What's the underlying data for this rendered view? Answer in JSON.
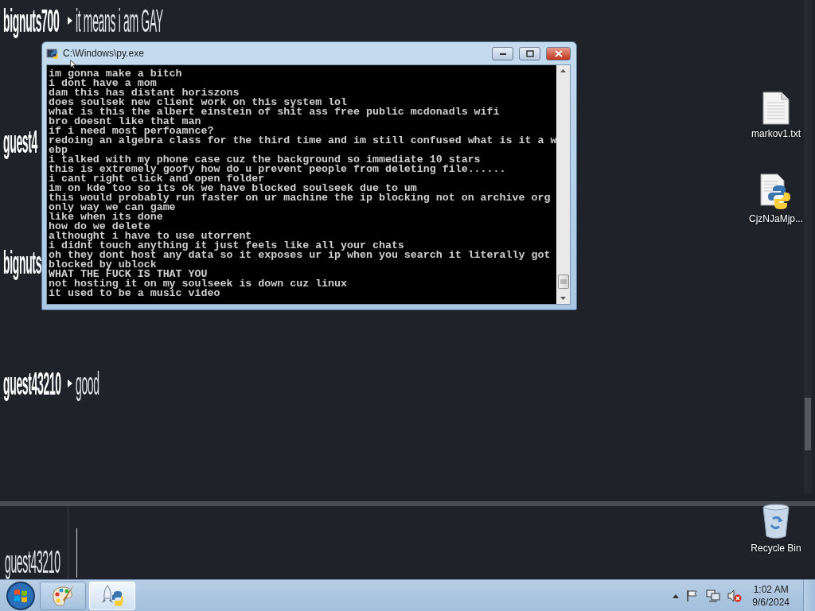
{
  "chat": {
    "messages": [
      {
        "user": "bignuts700",
        "text": "it means i am GAY"
      },
      {
        "user": "guest4"
      },
      {
        "user": "bignuts"
      },
      {
        "user": "guest43210",
        "text": "good"
      }
    ],
    "input": {
      "user": "guest43210"
    }
  },
  "console": {
    "title": "C:\\Windows\\py.exe",
    "lines": [
      "im gonna make a bitch",
      "i dont have a mom",
      "dam this has distant horiszons",
      "does soulsek new client work on this system lol",
      "what is this the albert einstein of shit ass free public mcdonadls wifi",
      "bro doesnt like that man",
      "if i need most perfoamnce?",
      "redoing an algebra class for the third time and im still confused what is it a w",
      "ebp",
      "i talked with my phone case cuz the background so immediate 10 stars",
      "this is extremely goofy how do u prevent people from deleting file......",
      "i cant right click and open folder",
      "im on kde too so its ok we have blocked soulseek due to um",
      "this would probably run faster on ur machine the ip blocking not on archive org",
      "only way we can game",
      "like when its done",
      "how do we delete",
      "althought i have to use utorrent",
      "i didnt touch anything it just feels like all your chats",
      "oh they dont host any data so it exposes ur ip when you search it literally got",
      "blocked by ublock",
      "WHAT THE FUCK IS THAT YOU",
      "not hosting it on my soulseek is down cuz linux",
      "it used to be a music video"
    ]
  },
  "desktop_icons": [
    {
      "kind": "text-file",
      "label": "markov1.txt"
    },
    {
      "kind": "python-file",
      "label": "CjzNJaMjp..."
    },
    {
      "kind": "recycle-bin",
      "label": "Recycle Bin"
    }
  ],
  "taskbar": {
    "apps": [
      {
        "kind": "paint",
        "selected": false
      },
      {
        "kind": "python-launcher",
        "selected": true
      }
    ],
    "volume_muted": true,
    "time": "1:02 AM",
    "date": "9/6/2024"
  }
}
